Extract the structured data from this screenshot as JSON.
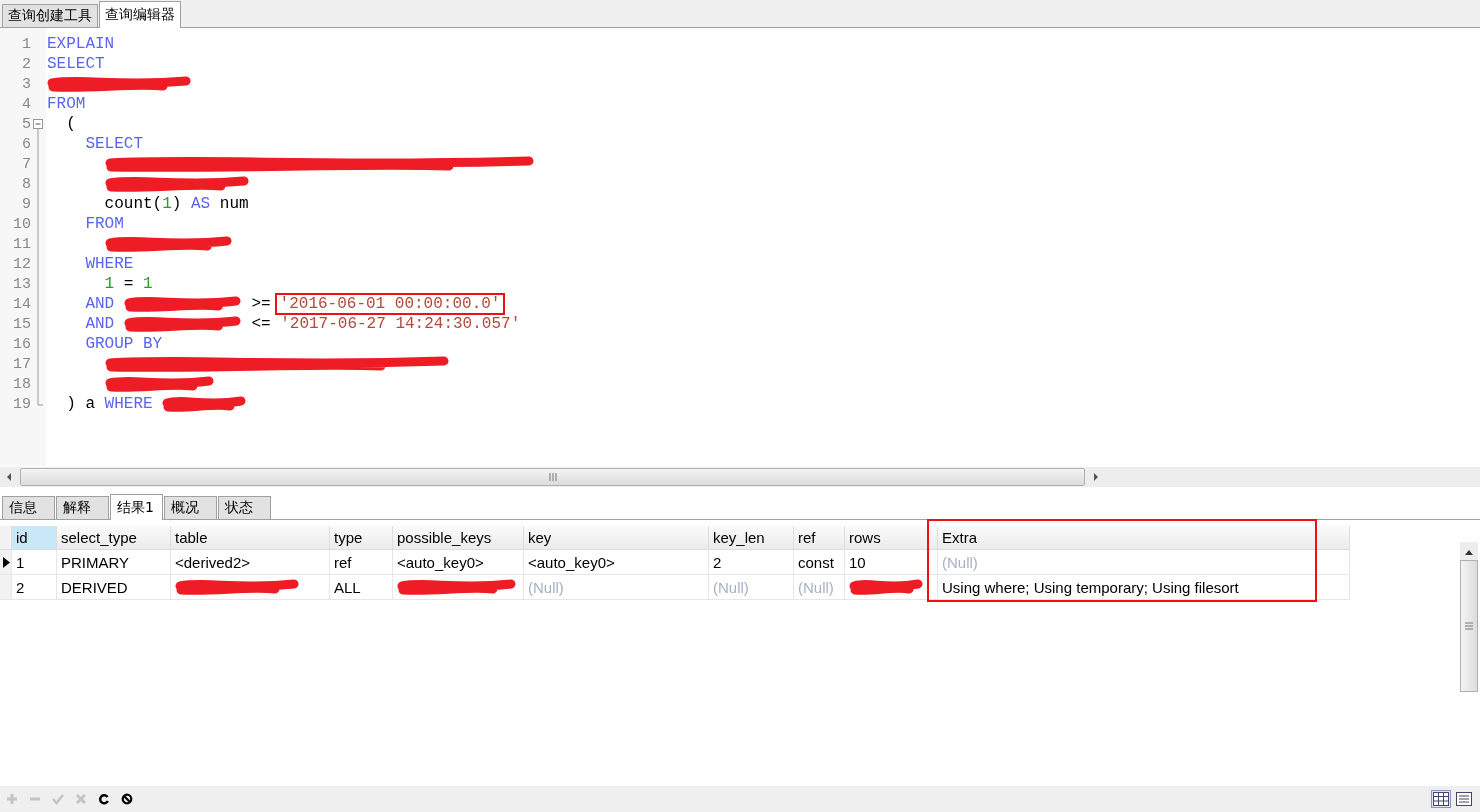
{
  "editor_tabs": [
    {
      "label": "查询创建工具",
      "selected": false
    },
    {
      "label": "查询编辑器",
      "selected": true
    }
  ],
  "code_lines": [
    {
      "number": "1",
      "tokens": [
        {
          "kind": "kw",
          "text": "EXPLAIN"
        }
      ]
    },
    {
      "number": "2",
      "tokens": [
        {
          "kind": "kw",
          "text": "SELECT"
        }
      ]
    },
    {
      "number": "3",
      "tokens": [
        {
          "kind": "redacted_l"
        }
      ]
    },
    {
      "number": "4",
      "tokens": [
        {
          "kind": "kw",
          "text": "FROM"
        }
      ],
      "children": [
        {
          "number": "5",
          "expanded": true,
          "tokens": [
            {
              "kind": "plain",
              "text": "("
            }
          ],
          "children": [
            {
              "number": "6",
              "tokens": [
                {
                  "kind": "kw",
                  "text": "SELECT"
                }
              ],
              "children": [
                {
                  "number": "7",
                  "tokens": [
                    {
                      "kind": "redacted_xxxl"
                    }
                  ]
                },
                {
                  "number": "8",
                  "tokens": [
                    {
                      "kind": "redacted_l"
                    }
                  ]
                },
                {
                  "number": "9",
                  "tokens": [
                    {
                      "kind": "plain",
                      "text": "count("
                    },
                    {
                      "kind": "num",
                      "text": "1",
                      "space": false
                    },
                    {
                      "kind": "plain",
                      "text": ")",
                      "space": false
                    },
                    {
                      "kind": "kw",
                      "text": "AS"
                    },
                    {
                      "kind": "plain",
                      "text": "num"
                    }
                  ]
                }
              ]
            },
            {
              "number": "10",
              "tokens": [
                {
                  "kind": "kw",
                  "text": "FROM"
                }
              ],
              "children": [
                {
                  "number": "11",
                  "tokens": [
                    {
                      "kind": "redacted_xl"
                    }
                  ]
                }
              ]
            },
            {
              "number": "12",
              "tokens": [
                {
                  "kind": "kw",
                  "text": "WHERE"
                }
              ],
              "children": [
                {
                  "number": "13",
                  "tokens": [
                    {
                      "kind": "num",
                      "text": "1"
                    },
                    {
                      "kind": "plain",
                      "text": "="
                    },
                    {
                      "kind": "num",
                      "text": "1"
                    }
                  ]
                }
              ]
            },
            {
              "number": "14",
              "tokens": [
                {
                  "kind": "kw",
                  "text": "AND"
                },
                {
                  "kind": "redacted_s"
                },
                {
                  "kind": "plain",
                  "text": ">="
                },
                {
                  "kind": "str",
                  "text": "'2016-06-01 00:00:00.0'",
                  "boxed": true
                }
              ]
            },
            {
              "number": "15",
              "tokens": [
                {
                  "kind": "kw",
                  "text": "AND"
                },
                {
                  "kind": "redacted_s"
                },
                {
                  "kind": "plain",
                  "text": "<="
                },
                {
                  "kind": "str",
                  "text": "'2017-06-27 14:24:30.057'",
                  "boxed": false
                }
              ]
            },
            {
              "number": "16",
              "tokens": [
                {
                  "kind": "kw",
                  "text": "GROUP BY"
                }
              ],
              "children": [
                {
                  "number": "17",
                  "tokens": [
                    {
                      "kind": "redacted_xxl"
                    }
                  ]
                },
                {
                  "number": "18",
                  "tokens": [
                    {
                      "kind": "redacted_m"
                    }
                  ]
                }
              ]
            }
          ]
        },
        {
          "number": "19",
          "tokens": [
            {
              "kind": "plain",
              "text": ")"
            },
            {
              "kind": "plain",
              "text": "a"
            },
            {
              "kind": "kw",
              "text": "WHERE"
            },
            {
              "kind": "redacted_xs"
            }
          ]
        }
      ]
    }
  ],
  "result_tabs": [
    {
      "label": "信息",
      "selected": false
    },
    {
      "label": "解释",
      "selected": false
    },
    {
      "label": "结果1",
      "selected": true
    },
    {
      "label": "概况",
      "selected": false
    },
    {
      "label": "状态",
      "selected": false
    }
  ],
  "table": {
    "columns": [
      {
        "label": "id",
        "current": true,
        "highlighted": false
      },
      {
        "label": "select_type",
        "current": false,
        "highlighted": false
      },
      {
        "label": "table",
        "current": false,
        "highlighted": false
      },
      {
        "label": "type",
        "current": false,
        "highlighted": false
      },
      {
        "label": "possible_keys",
        "current": false,
        "highlighted": false
      },
      {
        "label": "key",
        "current": false,
        "highlighted": false
      },
      {
        "label": "key_len",
        "current": false,
        "highlighted": false
      },
      {
        "label": "ref",
        "current": false,
        "highlighted": false
      },
      {
        "label": "rows",
        "current": false,
        "highlighted": false
      },
      {
        "label": "Extra",
        "current": false,
        "highlighted": true
      }
    ],
    "rows": [
      {
        "current": true,
        "cells": [
          {
            "kind": "value",
            "text": "1"
          },
          {
            "kind": "value",
            "text": "PRIMARY"
          },
          {
            "kind": "value",
            "text": "<derived2>"
          },
          {
            "kind": "value",
            "text": "ref"
          },
          {
            "kind": "value",
            "text": "<auto_key0>"
          },
          {
            "kind": "value",
            "text": "<auto_key0>"
          },
          {
            "kind": "value",
            "text": "2"
          },
          {
            "kind": "value",
            "text": "const"
          },
          {
            "kind": "value",
            "text": "10"
          },
          {
            "kind": "null",
            "text": "(Null)"
          }
        ]
      },
      {
        "current": false,
        "cells": [
          {
            "kind": "value",
            "text": "2"
          },
          {
            "kind": "value",
            "text": "DERIVED"
          },
          {
            "kind": "redacted_xl"
          },
          {
            "kind": "value",
            "text": "ALL"
          },
          {
            "kind": "redacted_m"
          },
          {
            "kind": "null",
            "text": "(Null)"
          },
          {
            "kind": "null",
            "text": "(Null)"
          },
          {
            "kind": "null",
            "text": "(Null)"
          },
          {
            "kind": "redacted_xs"
          },
          {
            "kind": "value",
            "text": "Using where; Using temporary; Using filesort"
          }
        ]
      }
    ]
  },
  "toolbar": [
    {
      "kind": "add",
      "disabled": true
    },
    {
      "kind": "remove",
      "disabled": true
    },
    {
      "kind": "apply",
      "disabled": true
    },
    {
      "kind": "cancel",
      "disabled": true
    },
    {
      "kind": "refresh",
      "disabled": false
    },
    {
      "kind": "stop",
      "disabled": false
    }
  ],
  "views": [
    {
      "kind": "grid",
      "selected": true
    },
    {
      "kind": "form",
      "selected": false
    }
  ]
}
